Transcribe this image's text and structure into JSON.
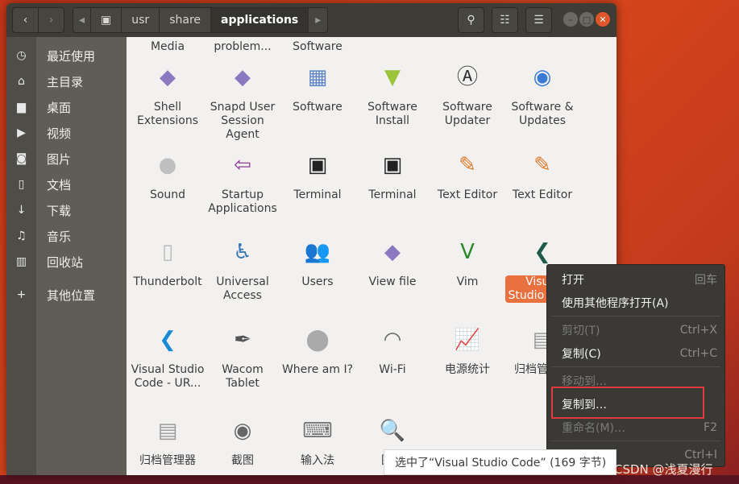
{
  "window": {
    "breadcrumb": [
      "usr",
      "share",
      "applications"
    ],
    "buttons": {
      "back": "‹",
      "forward": "›",
      "search": "search-icon",
      "view": "list-view-icon",
      "menu": "hamburger-icon"
    }
  },
  "sidebar": {
    "items": [
      {
        "icon": "clock-icon",
        "glyph": "◷",
        "label": "最近使用"
      },
      {
        "icon": "home-icon",
        "glyph": "⌂",
        "label": "主目录"
      },
      {
        "icon": "folder-icon",
        "glyph": "▆",
        "label": "桌面"
      },
      {
        "icon": "video-icon",
        "glyph": "▶",
        "label": "视频"
      },
      {
        "icon": "camera-icon",
        "glyph": "◙",
        "label": "图片"
      },
      {
        "icon": "document-icon",
        "glyph": "▯",
        "label": "文档"
      },
      {
        "icon": "download-icon",
        "glyph": "↓",
        "label": "下载"
      },
      {
        "icon": "music-icon",
        "glyph": "♫",
        "label": "音乐"
      },
      {
        "icon": "trash-icon",
        "glyph": "▥",
        "label": "回收站"
      },
      {
        "icon": "plus-icon",
        "glyph": "+",
        "label": "其他位置"
      }
    ]
  },
  "files": [
    {
      "label": "Media",
      "icon": "media-icon",
      "glyph": "",
      "color": "#888"
    },
    {
      "label": "problem...",
      "icon": "report-icon",
      "glyph": "",
      "color": "#888"
    },
    {
      "label": "Software",
      "icon": "software-icon",
      "glyph": "",
      "color": "#888"
    },
    {
      "label": "Shell Extensions",
      "icon": "diamond-icon",
      "glyph": "◆",
      "color": "#8a78c0"
    },
    {
      "label": "Snapd User Session Agent",
      "icon": "diamond-icon",
      "glyph": "◆",
      "color": "#8a78c0"
    },
    {
      "label": "Software",
      "icon": "shopping-bag-icon",
      "glyph": "▦",
      "color": "#5e86c4"
    },
    {
      "label": "Software Install",
      "icon": "package-download-icon",
      "glyph": "▼",
      "color": "#9cc43a"
    },
    {
      "label": "Software Updater",
      "icon": "updater-icon",
      "glyph": "Ⓐ",
      "color": "#333"
    },
    {
      "label": "Software & Updates",
      "icon": "package-globe-icon",
      "glyph": "◉",
      "color": "#3a7bd5"
    },
    {
      "label": "Sound",
      "icon": "sound-knob-icon",
      "glyph": "●",
      "color": "#c0c0c0"
    },
    {
      "label": "Startup Applications",
      "icon": "startup-icon",
      "glyph": "⇦",
      "color": "#8e3b9a"
    },
    {
      "label": "Terminal",
      "icon": "terminal-icon",
      "glyph": "▣",
      "color": "#222"
    },
    {
      "label": "Terminal",
      "icon": "terminal-icon",
      "glyph": "▣",
      "color": "#222"
    },
    {
      "label": "Text Editor",
      "icon": "text-editor-icon",
      "glyph": "✎",
      "color": "#e07a2a"
    },
    {
      "label": "Text Editor",
      "icon": "text-editor-icon",
      "glyph": "✎",
      "color": "#e07a2a"
    },
    {
      "label": "Thunderbolt",
      "icon": "file-icon",
      "glyph": "▯",
      "color": "#bbb"
    },
    {
      "label": "Universal Access",
      "icon": "accessibility-icon",
      "glyph": "♿",
      "color": "#3a78b8"
    },
    {
      "label": "Users",
      "icon": "users-icon",
      "glyph": "👥",
      "color": "#aaa"
    },
    {
      "label": "View file",
      "icon": "diamond-icon",
      "glyph": "◆",
      "color": "#8a78c0"
    },
    {
      "label": "Vim",
      "icon": "vim-icon",
      "glyph": "V",
      "color": "#2a8a2a"
    },
    {
      "label": "Visual Studio Code",
      "icon": "vscode-icon",
      "glyph": "❮",
      "color": "#1e5a4a",
      "selected": true
    },
    {
      "label": "Visual Studio Code - UR...",
      "icon": "vscode-icon",
      "glyph": "❮",
      "color": "#1a8ad4"
    },
    {
      "label": "Wacom Tablet",
      "icon": "tablet-pen-icon",
      "glyph": "✒",
      "color": "#555"
    },
    {
      "label": "Where am I?",
      "icon": "location-pin-icon",
      "glyph": "⬤",
      "color": "#aaa"
    },
    {
      "label": "Wi-Fi",
      "icon": "wifi-icon",
      "glyph": "◠",
      "color": "#666"
    },
    {
      "label": "电源统计",
      "icon": "power-stats-icon",
      "glyph": "📈",
      "color": "#c33"
    },
    {
      "label": "归档管理器",
      "icon": "archive-icon",
      "glyph": "▤",
      "color": "#999"
    },
    {
      "label": "归档管理器",
      "icon": "archive-icon",
      "glyph": "▤",
      "color": "#999"
    },
    {
      "label": "截图",
      "icon": "camera-icon",
      "glyph": "◉",
      "color": "#666"
    },
    {
      "label": "输入法",
      "icon": "keyboard-icon",
      "glyph": "⌨",
      "color": "#777"
    },
    {
      "label": "图像",
      "icon": "image-viewer-icon",
      "glyph": "🔍",
      "color": "#7a9a2a"
    }
  ],
  "context_menu": {
    "items": [
      {
        "label": "打开",
        "shortcut": "回车",
        "disabled": false
      },
      {
        "label": "使用其他程序打开(A)",
        "shortcut": "",
        "disabled": false
      },
      {
        "sep": true
      },
      {
        "label": "剪切(T)",
        "shortcut": "Ctrl+X",
        "disabled": true
      },
      {
        "label": "复制(C)",
        "shortcut": "Ctrl+C",
        "disabled": false
      },
      {
        "sep": true
      },
      {
        "label": "移动到…",
        "shortcut": "",
        "disabled": true
      },
      {
        "label": "复制到…",
        "shortcut": "",
        "disabled": false,
        "highlighted": true
      },
      {
        "label": "重命名(M)…",
        "shortcut": "F2",
        "disabled": true
      },
      {
        "sep": true
      },
      {
        "label": "属性(P)",
        "shortcut": "Ctrl+I",
        "disabled": false
      }
    ]
  },
  "status": "选中了“Visual Studio Code” (169 字节)",
  "watermark": "CSDN @浅夏漫行",
  "colors": {
    "selection": "#e9703f",
    "highlight_box": "#e03a3a",
    "close_button": "#e0552a"
  }
}
